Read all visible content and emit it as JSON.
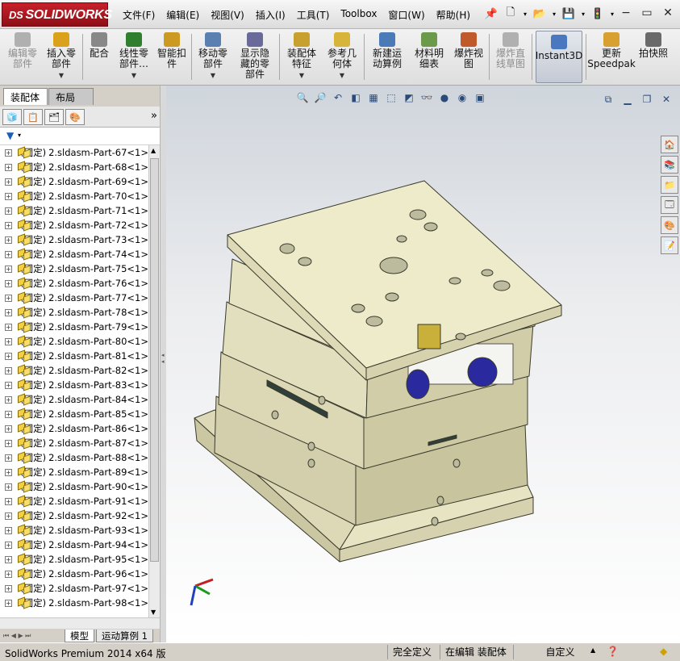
{
  "app": {
    "logo_text": "SOLIDWORKS",
    "logo_prefix": "DS"
  },
  "menu": [
    "文件(F)",
    "编辑(E)",
    "视图(V)",
    "插入(I)",
    "工具(T)",
    "Toolbox",
    "窗口(W)",
    "帮助(H)"
  ],
  "quick_access": {
    "new_icon": "new-document-icon",
    "open_icon": "open-folder-icon",
    "save_icon": "save-icon",
    "rebuild_icon": "traffic-light-icon"
  },
  "window_controls": [
    "−",
    "▭",
    "✕"
  ],
  "commands": [
    {
      "label": "编辑零\n部件",
      "disabled": true,
      "arrow": false
    },
    {
      "label": "插入零\n部件",
      "disabled": false,
      "arrow": true
    },
    {
      "label": "配合",
      "disabled": false,
      "arrow": false
    },
    {
      "label": "线性零\n部件…",
      "disabled": false,
      "arrow": true
    },
    {
      "label": "智能扣\n件",
      "disabled": false,
      "arrow": false
    },
    {
      "label": "移动零\n部件",
      "disabled": false,
      "arrow": true
    },
    {
      "label": "显示隐\n藏的零\n部件",
      "disabled": false,
      "arrow": false
    },
    {
      "label": "装配体\n特征",
      "disabled": false,
      "arrow": true
    },
    {
      "label": "参考几\n何体",
      "disabled": false,
      "arrow": true
    },
    {
      "label": "新建运\n动算例",
      "disabled": false,
      "arrow": false
    },
    {
      "label": "材料明\n细表",
      "disabled": false,
      "arrow": false
    },
    {
      "label": "爆炸视\n图",
      "disabled": false,
      "arrow": false
    },
    {
      "label": "爆炸直\n线草图",
      "disabled": true,
      "arrow": false
    },
    {
      "label": "Instant3D",
      "disabled": false,
      "arrow": false
    },
    {
      "label": "更新\nSpeedpak",
      "disabled": false,
      "arrow": false
    },
    {
      "label": "拍快照",
      "disabled": false,
      "arrow": false
    }
  ],
  "tabs": {
    "assembly": "装配体",
    "layout": "布局"
  },
  "tree": {
    "fixed_label": "(固定)",
    "items": [
      "2.sldasm-Part-67<1>",
      "2.sldasm-Part-68<1>",
      "2.sldasm-Part-69<1>",
      "2.sldasm-Part-70<1>",
      "2.sldasm-Part-71<1>",
      "2.sldasm-Part-72<1>",
      "2.sldasm-Part-73<1>",
      "2.sldasm-Part-74<1>",
      "2.sldasm-Part-75<1>",
      "2.sldasm-Part-76<1>",
      "2.sldasm-Part-77<1>",
      "2.sldasm-Part-78<1>",
      "2.sldasm-Part-79<1>",
      "2.sldasm-Part-80<1>",
      "2.sldasm-Part-81<1>",
      "2.sldasm-Part-82<1>",
      "2.sldasm-Part-83<1>",
      "2.sldasm-Part-84<1>",
      "2.sldasm-Part-85<1>",
      "2.sldasm-Part-86<1>",
      "2.sldasm-Part-87<1>",
      "2.sldasm-Part-88<1>",
      "2.sldasm-Part-89<1>",
      "2.sldasm-Part-90<1>",
      "2.sldasm-Part-91<1>",
      "2.sldasm-Part-92<1>",
      "2.sldasm-Part-93<1>",
      "2.sldasm-Part-94<1>",
      "2.sldasm-Part-95<1>",
      "2.sldasm-Part-96<1>",
      "2.sldasm-Part-97<1>",
      "2.sldasm-Part-98<1>"
    ]
  },
  "bottom_tabs": {
    "model": "模型",
    "motion": "运动算例 1"
  },
  "status": {
    "app": "SolidWorks Premium 2014 x64 版",
    "defined": "完全定义",
    "editing": "在编辑 装配体",
    "units": "自定义"
  },
  "colors": {
    "model_fill": "#eeebcb",
    "model_edge": "#3a3a2c",
    "accent": "#c8212b"
  }
}
